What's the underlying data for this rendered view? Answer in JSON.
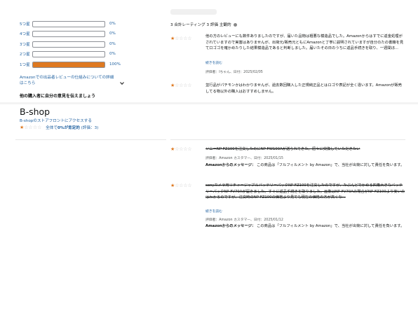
{
  "histogram": {
    "rows": [
      {
        "label": "5つ星",
        "pct_text": "0%",
        "fill": 0
      },
      {
        "label": "4つ星",
        "pct_text": "0%",
        "fill": 0
      },
      {
        "label": "3つ星",
        "pct_text": "0%",
        "fill": 0
      },
      {
        "label": "2つ星",
        "pct_text": "0%",
        "fill": 0
      },
      {
        "label": "1つ星",
        "pct_text": "100%",
        "fill": 100
      }
    ],
    "help_link": "Amazonでの出品者レビューの仕組みについての詳細はこちら",
    "share_heading": "他の購入者に自分の意見を伝えましょう"
  },
  "rating_summary": {
    "text": "3 合計レーティング 3 評価 主観的"
  },
  "seller": {
    "name": "B-shop",
    "storefront_link": "B-shopのストアフロントにアクセスする",
    "overall": "全体で",
    "percent": "0%が肯定的",
    "count": "(評価：3)",
    "stars": 1
  },
  "reviews": [
    {
      "stars": 1,
      "text": "他の方のレビューにも数件ありましたのですが、届いた品物は粗悪な模造品でした。Amazonからはすでに返金処理がされていますので実害はありませんが、出荷元/販売元ともにAmazonと丁寧に説明されていますが自分のたの書籍を見て口ゴゴを確かめたりした結果模造品であると判断しました。届いたその日のうちに返品手続きを取り、一週間ほ...",
      "read_more": "続きを読む",
      "meta": "評価者：Iちゃん、日付：2025/02/05",
      "strike": false
    },
    {
      "stars": 1,
      "text": "並行品がパチモンかはわかりませんが、過去数回購入した正規純正品とはロゴや表記が全く違います。Amazonが販売してる物以外の購入はおすすめしません。",
      "read_more": "",
      "meta": "",
      "strike": false
    },
    {
      "stars": 1,
      "text": "ソニーNP-FZ100を注文したのにNP-FW100Aが送られてきた。週々に交換していただきたい",
      "read_more": "",
      "meta": "評価者：Amazon カスタマー、日付：2025/01/15",
      "message_label": "Amazonからのメッセージ：",
      "message": "この商品は「フルフィルメント by Amazon」で、当社が出荷に対して責任を負います。",
      "strike": true
    },
    {
      "stars": 1,
      "text": "sonyカメラ用リチャージャブルバッテリーパックNP-FZ100を注文したのですが、たぶんどでかめる四角大きなバッテリーパックNP-FV70Aが届きました。すぐに返品手続きを取りました。画像はNP-FV70Aの場合がNP-FZ100より安いのはわかるのですが、注文時のNP-FZ100の価格より見ても現在の価格の方が高くな...",
      "read_more": "続きを読む",
      "meta": "評価者：Amazon カスタマー、日付：2025/01/12",
      "message_label": "Amazonからのメッセージ：",
      "message": "この商品は「フルフィルメント by Amazon」で、当社が出荷に対して責任を負います。",
      "strike": true
    }
  ],
  "colors": {
    "star": "#de7921",
    "link": "#2162a1",
    "bar_fill": "#de7921"
  }
}
